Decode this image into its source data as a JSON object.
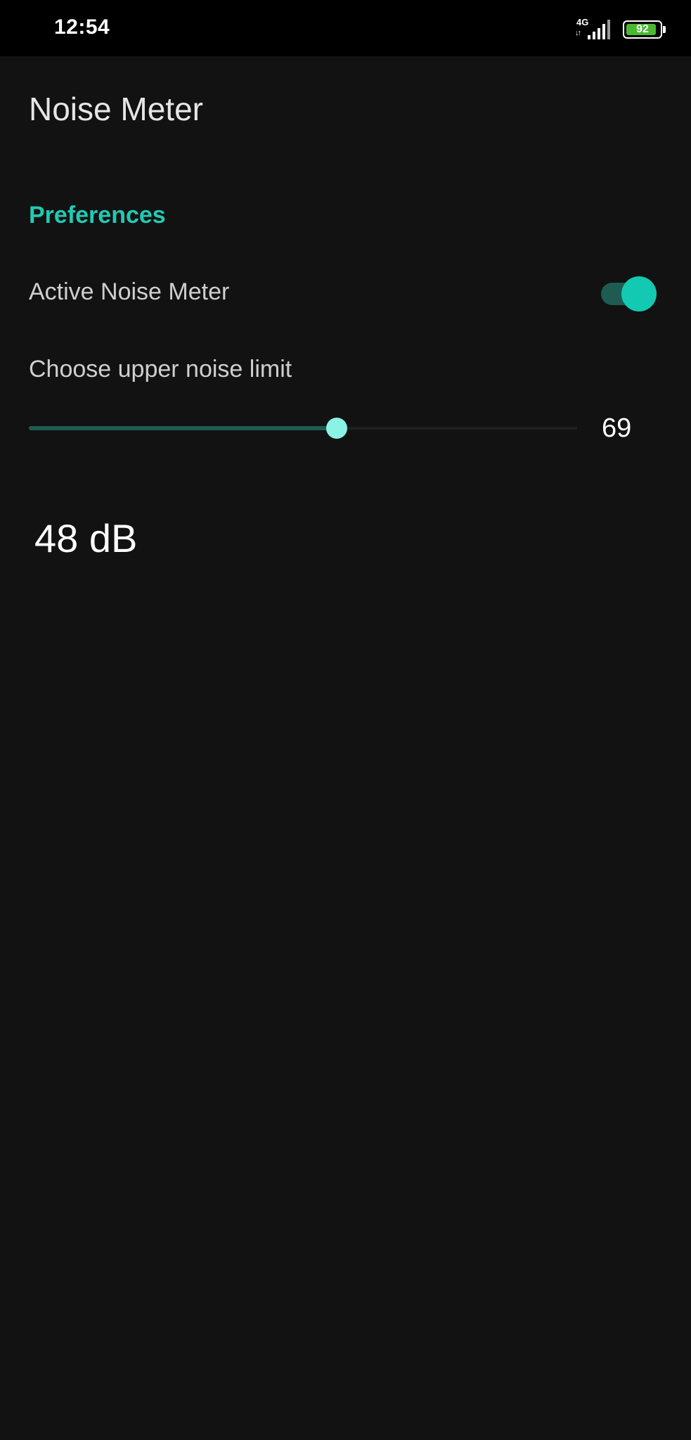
{
  "status_bar": {
    "time": "12:54",
    "network_type": "4G",
    "battery_level": "92",
    "battery_fraction": 0.92,
    "icons": [
      "signal-icon",
      "data-arrows-icon",
      "battery-icon"
    ]
  },
  "app_bar": {
    "title": "Noise Meter"
  },
  "preferences": {
    "category_title": "Preferences",
    "active_switch": {
      "label": "Active Noise Meter",
      "checked": true
    },
    "noise_limit": {
      "title": "Choose upper noise limit",
      "value": "69",
      "min": 0,
      "max": 120,
      "fraction": 0.562
    }
  },
  "reading": {
    "text": "48 dB"
  },
  "colors": {
    "background": "#121212",
    "accent": "#22c9b2",
    "switch_thumb": "#14c9b1",
    "switch_track": "#1e5b52",
    "seek_thumb": "#8af3e3",
    "battery_fill": "#4ab831"
  }
}
